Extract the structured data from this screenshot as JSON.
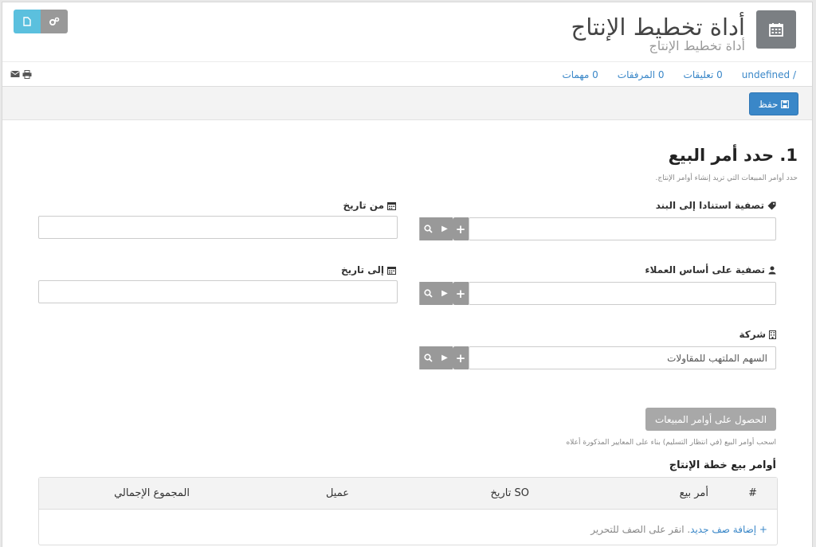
{
  "header": {
    "title": "أداة تخطيط الإنتاج",
    "subtitle": "أداة تخطيط الإنتاج",
    "icon": "calendar-icon"
  },
  "links": {
    "breadcrumb": "undefined",
    "separator": "/",
    "comments": "0 تعليقات",
    "attachments": "0 المرفقات",
    "tasks": "0 مهمات"
  },
  "toolbar": {
    "save_label": "حفظ"
  },
  "section": {
    "title": "1. حدد أمر البيع",
    "description": "حدد أوامر المبيعات التي تريد إنشاء أوامر الإنتاج."
  },
  "fields": {
    "item_filter_label": "تصفية استنادا إلى البند",
    "item_filter_value": "",
    "from_date_label": "من تاريخ",
    "from_date_value": "",
    "customer_filter_label": "تصفية على أساس العملاء",
    "customer_filter_value": "",
    "to_date_label": "إلى تاريخ",
    "to_date_value": "",
    "company_label": "شركة",
    "company_value": "السهم الملتهب للمقاولات"
  },
  "get_orders": {
    "button_label": "الحصول على أوامر المبيعات",
    "hint": "اسحب أوامر البيع (في انتظار التسليم) بناء على المعايير المذكورة أعلاه"
  },
  "table": {
    "title": "أوامر بيع خطة الإنتاج",
    "columns": [
      "#",
      "أمر بيع",
      "SO تاريخ",
      "عميل",
      "المجموع الإجمالي"
    ],
    "add_row": "+ إضافة صف جديد",
    "add_row_hint": ". انقر على الصف للتحرير"
  },
  "colors": {
    "primary": "#3a87c8",
    "info": "#5bc0de",
    "muted_button": "#999999"
  }
}
